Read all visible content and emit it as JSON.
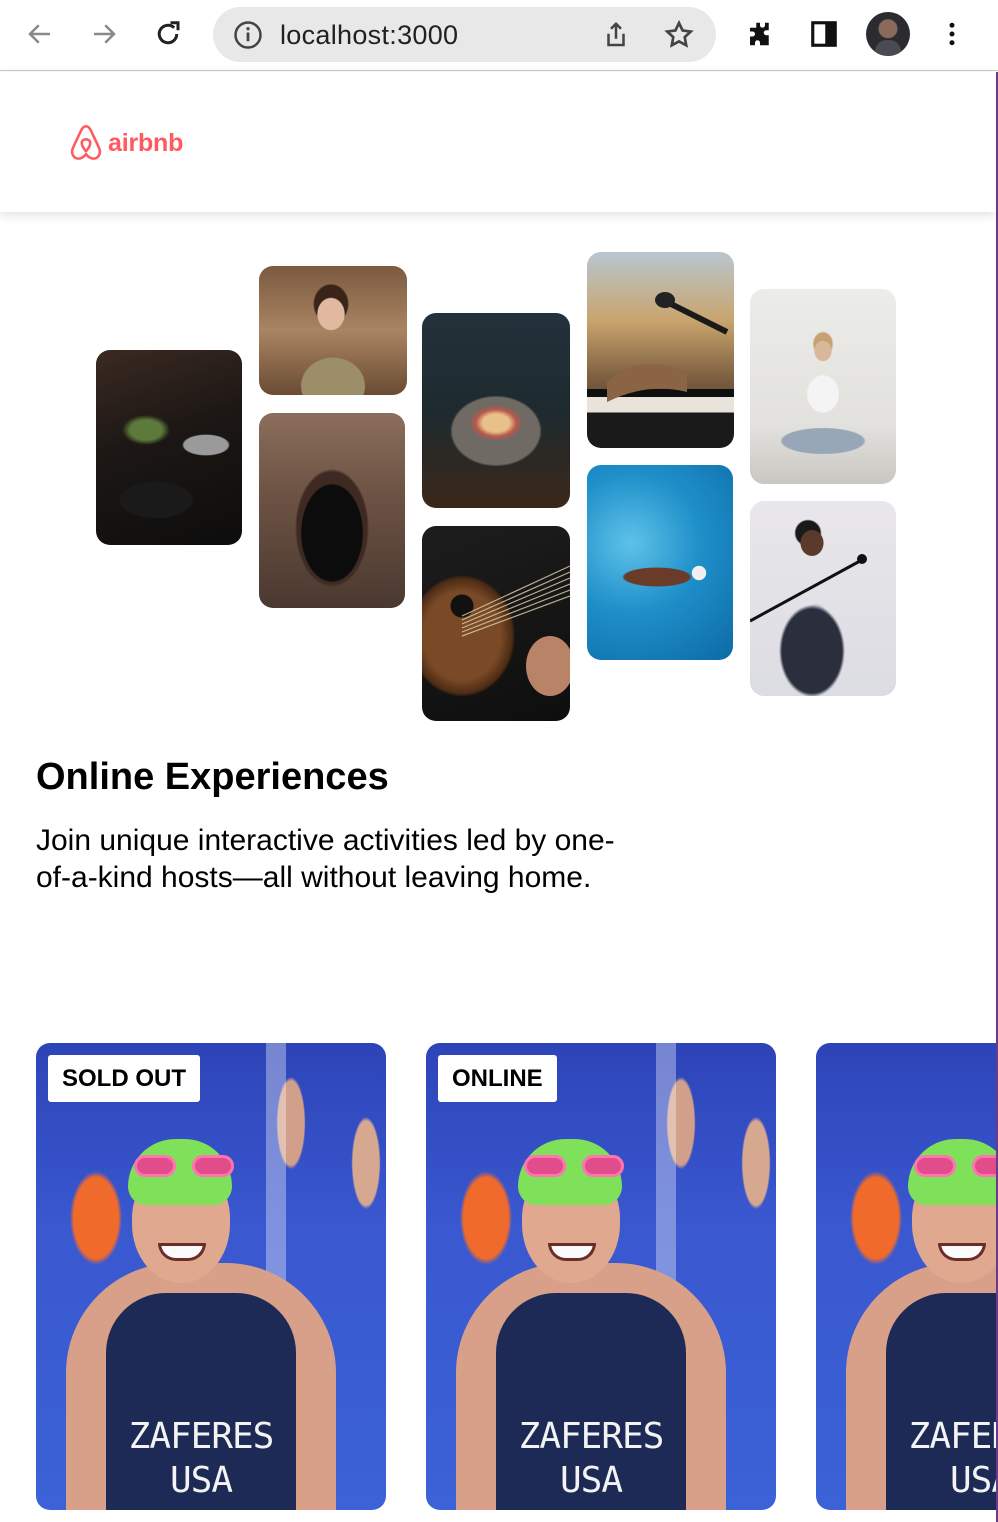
{
  "browser": {
    "url": "localhost:3000",
    "icons": [
      "back-arrow-icon",
      "forward-arrow-icon",
      "reload-icon",
      "info-icon",
      "share-icon",
      "star-icon",
      "extensions-icon",
      "sidepanel-icon",
      "profile-avatar",
      "more-menu-icon"
    ]
  },
  "header": {
    "logo_text": "airbnb",
    "brand_color": "#FF5A5F"
  },
  "hero": {
    "photos": [
      "cooking",
      "woman-with-macarons",
      "dancer-in-doorway",
      "stone-bowl-food",
      "acoustic-guitar",
      "piano-microphone",
      "swimmer",
      "yoga",
      "singer"
    ],
    "title": "Online Experiences",
    "subtitle": "Join unique interactive activities led by one-of-a-kind hosts—all without leaving home."
  },
  "cards": [
    {
      "badge": "SOLD OUT",
      "suit_line1": "ZAFERES",
      "suit_line2": "USA"
    },
    {
      "badge": "ONLINE",
      "suit_line1": "ZAFERES",
      "suit_line2": "USA"
    },
    {
      "badge": "",
      "suit_line1": "ZAFERES",
      "suit_line2": "USA"
    }
  ]
}
